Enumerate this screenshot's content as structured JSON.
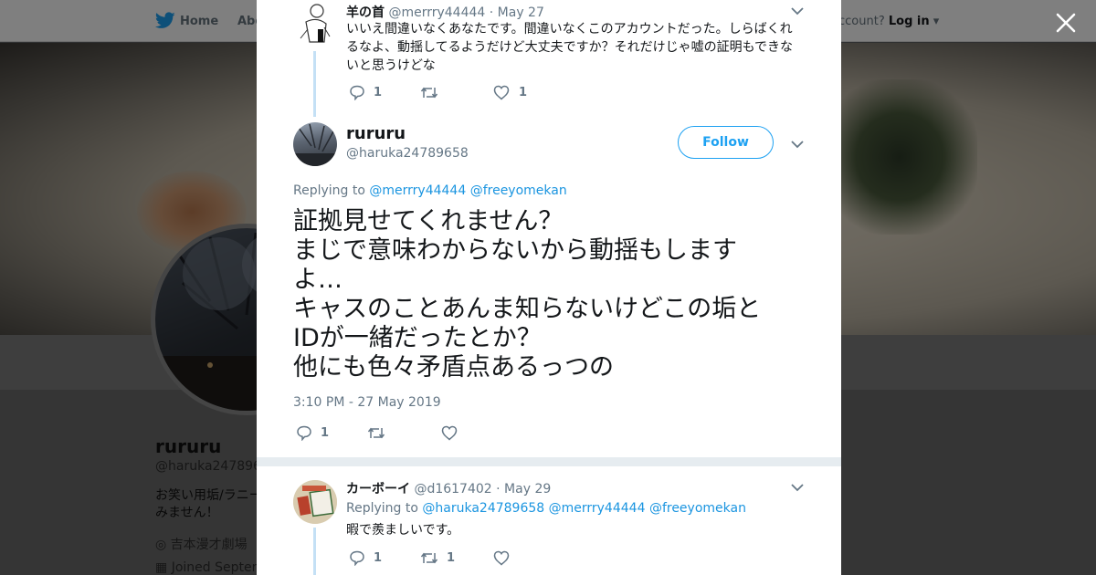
{
  "background": {
    "nav": {
      "home": "Home",
      "about": "Abo"
    },
    "login": {
      "prefix": "ccount?",
      "link": "Log in"
    },
    "profile": {
      "name": "rururu",
      "handle": "@haruka2478965",
      "bio": "お笑い用垢/ラニーみません！",
      "location": "吉本漫才劇場",
      "joined": "Joined Septen"
    }
  },
  "modal": {
    "prev_tweet": {
      "name": "羊の首",
      "handle": "@merrry44444",
      "date": "· May 27",
      "text_lines": [
        "いいえ間違いなくあなたです。間違いなくこのアカウントだった。しらばくれ",
        "るなよ、動揺してるようだけど大丈夫ですか？それだけじゃ嘘の証明もできな",
        "いと思うけどな"
      ],
      "replies": "1",
      "likes": "1"
    },
    "main_tweet": {
      "name": "rururu",
      "handle": "@haruka24789658",
      "follow_label": "Follow",
      "replying_prefix": "Replying to",
      "replying_to": [
        "@merrry44444",
        "@freeyomekan"
      ],
      "text_lines": [
        "証拠見せてくれません？",
        "まじで意味わからないから動揺もします",
        "よ…",
        "キャスのことあんま知らないけどこの垢と",
        "IDが一緒だったとか？",
        "他にも色々矛盾点あるっつの"
      ],
      "timestamp": "3:10 PM - 27 May 2019",
      "replies": "1"
    },
    "reply_tweet": {
      "name": "カーボーイ",
      "handle": "@d1617402",
      "date": "· May 29",
      "replying_prefix": "Replying to",
      "replying_to": [
        "@haruka24789658",
        "@merrry44444",
        "@freeyomekan"
      ],
      "text": "暇で羨ましいです。",
      "replies": "1",
      "retweets": "1"
    }
  },
  "colors": {
    "link": "#1b95e0",
    "follow": "#1da1f2",
    "text": "#14171a",
    "muted": "#657786"
  }
}
